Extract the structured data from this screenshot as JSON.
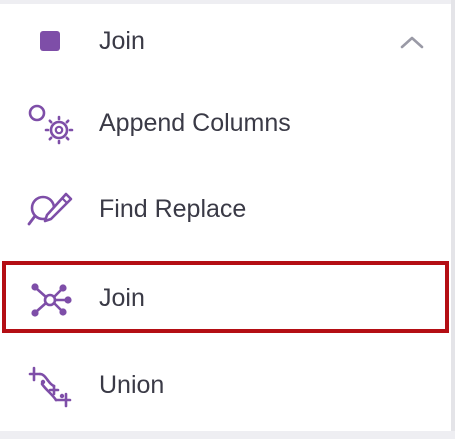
{
  "group": {
    "label": "Join",
    "expanded": true,
    "accent_color": "#7e4ea8"
  },
  "items": [
    {
      "label": "Append Columns",
      "icon": "append-columns-icon"
    },
    {
      "label": "Find Replace",
      "icon": "find-replace-icon"
    },
    {
      "label": "Join",
      "icon": "join-icon",
      "selected": true
    },
    {
      "label": "Union",
      "icon": "union-icon"
    }
  ],
  "colors": {
    "icon": "#7e4ea8",
    "text": "#3a3a46",
    "selection_border": "#b40e14"
  }
}
